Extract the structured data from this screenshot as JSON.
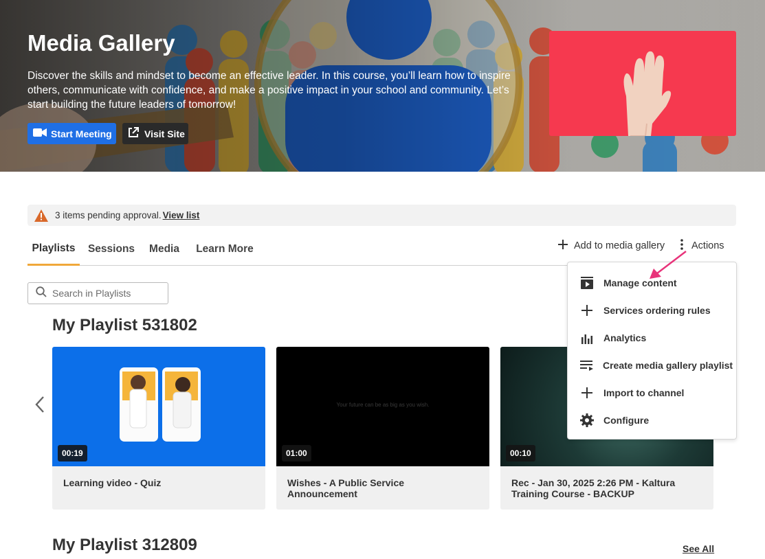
{
  "hero": {
    "title": "Media Gallery",
    "description": "Discover the skills and mindset to become an effective leader. In this course, you’ll learn how to inspire others, communicate with confidence, and make a positive impact in your school and community. Let’s start building the future leaders of tomorrow!",
    "start_meeting_label": "Start Meeting",
    "visit_site_label": "Visit Site",
    "thumbnail_color": "#f6394f"
  },
  "alert": {
    "text": "3 items pending approval.",
    "link_label": "View list",
    "icon": "warning-icon",
    "icon_color": "#d9692a"
  },
  "tabs": [
    {
      "label": "Playlists",
      "active": true
    },
    {
      "label": "Sessions",
      "active": false
    },
    {
      "label": "Media",
      "active": false
    },
    {
      "label": "Learn More",
      "active": false
    }
  ],
  "toolbar": {
    "add_label": "Add to media gallery",
    "actions_label": "Actions"
  },
  "search": {
    "placeholder": "Search in Playlists",
    "value": ""
  },
  "playlists": [
    {
      "title": "My Playlist 531802",
      "entries": [
        {
          "title": "Learning video - Quiz",
          "duration": "00:19"
        },
        {
          "title": "Wishes - A Public Service Announcement",
          "duration": "01:00",
          "overlay_text": "Your future can be as big as you wish."
        },
        {
          "title": "Rec - Jan 30, 2025 2:26 PM - Kaltura Training Course - BACKUP",
          "duration": "00:10"
        }
      ]
    },
    {
      "title": "My Playlist 312809",
      "see_all_label": "See All"
    }
  ],
  "actions_menu": {
    "items": [
      {
        "label": "Manage content",
        "icon": "play-box-icon"
      },
      {
        "label": "Services ordering rules",
        "icon": "plus-icon"
      },
      {
        "label": "Analytics",
        "icon": "bar-chart-icon"
      },
      {
        "label": "Create media gallery playlist",
        "icon": "playlist-add-icon"
      },
      {
        "label": "Import to channel",
        "icon": "plus-icon"
      },
      {
        "label": "Configure",
        "icon": "gear-icon"
      }
    ]
  },
  "colors": {
    "accent": "#f0a83a",
    "primary_button": "#1f6fe5",
    "annotation_arrow": "#e8337a"
  }
}
